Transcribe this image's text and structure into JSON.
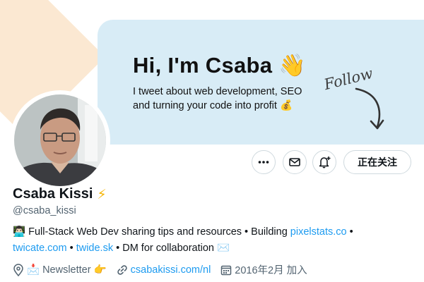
{
  "banner": {
    "greeting": "Hi, I'm Csaba 👋",
    "tagline": "I tweet about web development, SEO and turning your code into profit 💰",
    "follow_hand": "Follow"
  },
  "actions": {
    "more_icon": "more-horizontal-icon",
    "message_icon": "envelope-icon",
    "notify_icon": "bell-plus-icon",
    "follow_state_label": "正在关注"
  },
  "profile": {
    "display_name": "Csaba Kissi",
    "name_badge": "⚡",
    "handle": "@csaba_kissi",
    "bio": {
      "prefix": "👨🏻‍💻 Full-Stack Web Dev sharing tips and resources • Building ",
      "link1": "pixelstats.co",
      "sep1": " • ",
      "link2": "twicate.com",
      "sep2": " • ",
      "link3": "twide.sk",
      "suffix": " • DM for collaboration ✉️"
    },
    "meta": {
      "location": "📩 Newsletter 👉",
      "website": "csabakissi.com/nl",
      "joined": "2016年2月 加入"
    }
  },
  "colors": {
    "link": "#1d9bf0",
    "muted": "#536471",
    "banner_blue": "#d8ecf6",
    "banner_peach": "#fbe8d2"
  }
}
